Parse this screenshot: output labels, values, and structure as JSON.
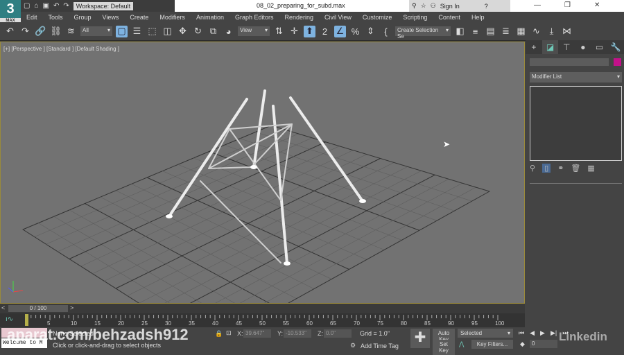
{
  "app": {
    "logo": "3",
    "logo_sub": "MAX",
    "workspace": "Workspace: Default",
    "title": "08_02_preparing_for_subd.max",
    "sign_in": "Sign In"
  },
  "menu": [
    "Edit",
    "Tools",
    "Group",
    "Views",
    "Create",
    "Modifiers",
    "Animation",
    "Graph Editors",
    "Rendering",
    "Civil View",
    "Customize",
    "Scripting",
    "Content",
    "Help"
  ],
  "toolbar": {
    "filter": "All",
    "ref_coord": "View",
    "selection_set": "Create Selection Se"
  },
  "viewport": {
    "label": "[+] [Perspective ] [Standard ] [Default Shading ]"
  },
  "command_panel": {
    "tabs": [
      "+",
      "modify",
      "hierarchy",
      "motion",
      "display",
      "utilities"
    ],
    "modifier_list": "Modifier List",
    "object_color": "#c3118a"
  },
  "timeline": {
    "position": "0 / 100",
    "prev": "<",
    "next": ">",
    "ticks": [
      0,
      5,
      10,
      15,
      20,
      25,
      30,
      35,
      40,
      45,
      50,
      55,
      60,
      65,
      70,
      75,
      80,
      85,
      90,
      95,
      100
    ],
    "current": 0
  },
  "status": {
    "listener": "Welcome to M",
    "selection": "None Selected",
    "prompt": "Click or click-and-drag to select objects",
    "x": "39.647\"",
    "y": "-10.533\"",
    "z": "0.0\"",
    "x_label": "X:",
    "y_label": "Y:",
    "z_label": "Z:",
    "grid": "Grid = 1.0\"",
    "add_time_tag": "Add Time Tag",
    "auto_key": "Auto Key",
    "set_key": "Set Key",
    "key_mode": "Selected",
    "key_filters": "Key Filters...",
    "frame": "0"
  },
  "watermark": "aparat.com/behzadsh912",
  "brand_watermark": "Linkedin"
}
